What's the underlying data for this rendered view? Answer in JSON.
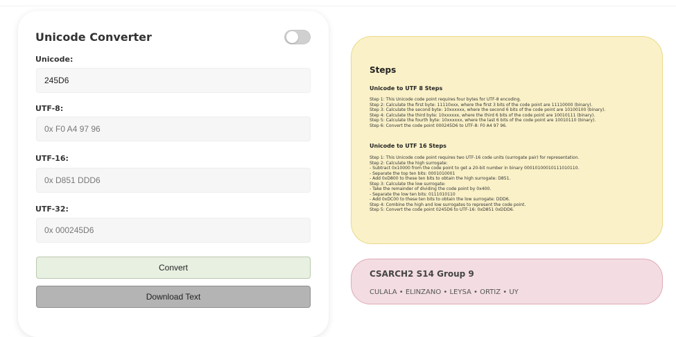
{
  "converter": {
    "title": "Unicode Converter",
    "fields": [
      {
        "label": "Unicode:",
        "value": "245D6"
      },
      {
        "label": "UTF-8:",
        "value": "0x F0 A4 97 96"
      },
      {
        "label": "UTF-16:",
        "value": "0x D851 DDD6"
      },
      {
        "label": "UTF-32:",
        "value": "0x 000245D6"
      }
    ],
    "convert_label": "Convert",
    "download_label": "Download Text",
    "toggle_on": false
  },
  "steps": {
    "title": "Steps",
    "utf8_heading": "Unicode to UTF 8 Steps",
    "utf8_lines": [
      "Step 1: This Unicode code point requires four bytes for UTF-8 encoding.",
      "Step 2: Calculate the first byte: 11110xxx, where the first 3 bits of the code point are 11110000 (binary).",
      "Step 3: Calculate the second byte: 10xxxxxx, where the second 6 bits of the code point are 10100100 (binary).",
      "Step 4: Calculate the third byte: 10xxxxxx, where the third 6 bits of the code point are 10010111 (binary).",
      "Step 5: Calculate the fourth byte: 10xxxxxx, where the last 6 bits of the code point are 10010110 (binary).",
      "Step 6: Convert the code point 000245D6 to UTF-8: F0 A4 97 96."
    ],
    "utf16_heading": "Unicode to UTF 16 Steps",
    "utf16_lines": [
      "Step 1: This Unicode code point requires two UTF-16 code units (surrogate pair) for representation.",
      "Step 2: Calculate the high surrogate:",
      "- Subtract 0x10000 from the code point to get a 20-bit number in binary 00010100010111010110.",
      "- Separate the top ten bits: 0001010001",
      "- Add 0xD800 to these ten bits to obtain the high surrogate: D851.",
      "Step 3: Calculate the low surrogate:",
      "- Take the remainder of dividing the code point by 0x400.",
      "- Separate the low ten bits: 0111010110",
      "- Add 0xDC00 to these ten bits to obtain the low surrogate: DDD6.",
      "Step 4: Combine the high and low surrogates to represent the code point.",
      "Step 5: Convert the code point 0245D6 to UTF-16: 0xD851 0xDDD6."
    ]
  },
  "group": {
    "title": "CSARCH2 S14 Group 9",
    "members": "CULALA • ELINZANO • LEYSA • ORTIZ • UY"
  }
}
